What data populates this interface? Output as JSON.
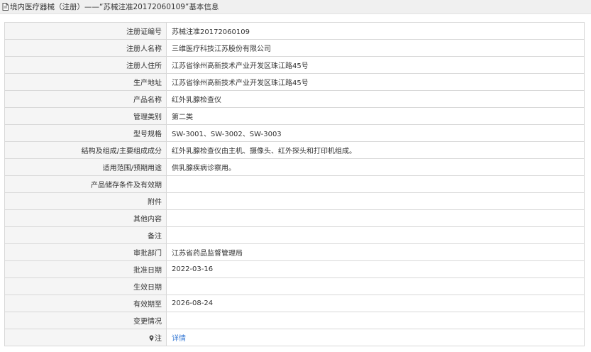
{
  "header": {
    "title": "境内医疗器械（注册）——“苏械注准20172060109”基本信息"
  },
  "rows": [
    {
      "label": "注册证编号",
      "value": "苏械注准20172060109"
    },
    {
      "label": "注册人名称",
      "value": "三维医疗科技江苏股份有限公司"
    },
    {
      "label": "注册人住所",
      "value": "江苏省徐州高新技术产业开发区珠江路45号"
    },
    {
      "label": "生产地址",
      "value": "江苏省徐州高新技术产业开发区珠江路45号"
    },
    {
      "label": "产品名称",
      "value": "红外乳腺检查仪"
    },
    {
      "label": "管理类别",
      "value": "第二类"
    },
    {
      "label": "型号规格",
      "value": "SW-3001、SW-3002、SW-3003"
    },
    {
      "label": "结构及组成/主要组成成分",
      "value": "红外乳腺检查仪由主机、摄像头、红外探头和打印机组成。"
    },
    {
      "label": "适用范围/预期用途",
      "value": "供乳腺疾病诊察用。"
    },
    {
      "label": "产品储存条件及有效期",
      "value": ""
    },
    {
      "label": "附件",
      "value": ""
    },
    {
      "label": "其他内容",
      "value": ""
    },
    {
      "label": "备注",
      "value": ""
    },
    {
      "label": "审批部门",
      "value": "江苏省药品监督管理局"
    },
    {
      "label": "批准日期",
      "value": "2022-03-16"
    },
    {
      "label": "生效日期",
      "value": ""
    },
    {
      "label": "有效期至",
      "value": "2026-08-24"
    },
    {
      "label": "变更情况",
      "value": ""
    }
  ],
  "note_row": {
    "label": "注",
    "icon": "location-pin-icon",
    "link_text": "详情"
  },
  "colors": {
    "link": "#3a7bd5",
    "label_bg": "#f5f5f5",
    "border": "#d8d8d8"
  }
}
